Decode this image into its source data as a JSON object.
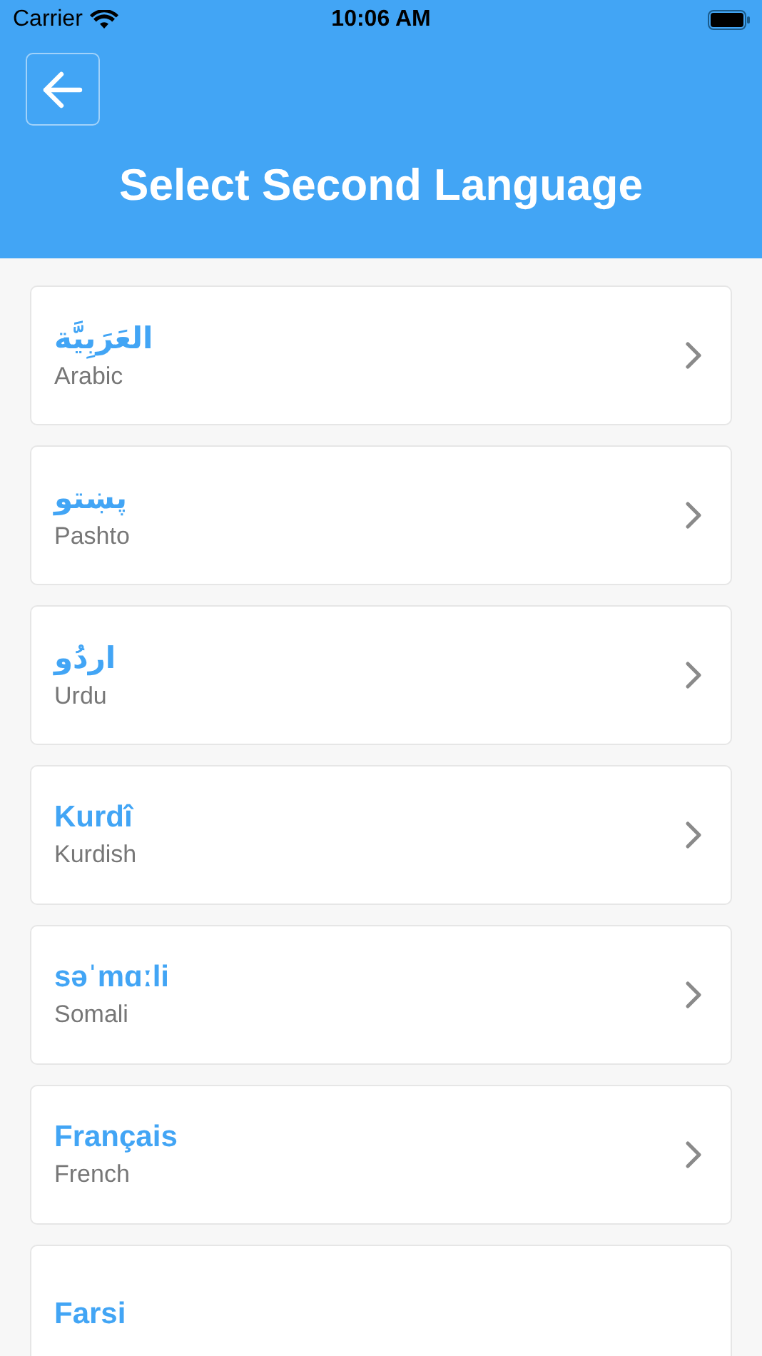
{
  "status_bar": {
    "carrier": "Carrier",
    "time": "10:06 AM"
  },
  "header": {
    "title": "Select Second Language"
  },
  "languages": [
    {
      "native": "العَرَبِيَّة",
      "english": "Arabic"
    },
    {
      "native": "پښتو",
      "english": "Pashto"
    },
    {
      "native": "اردُو",
      "english": "Urdu"
    },
    {
      "native": "Kurdî",
      "english": "Kurdish"
    },
    {
      "native": "səˈmɑːli",
      "english": "Somali"
    },
    {
      "native": "Français",
      "english": "French"
    },
    {
      "native": "Farsi"
    }
  ]
}
